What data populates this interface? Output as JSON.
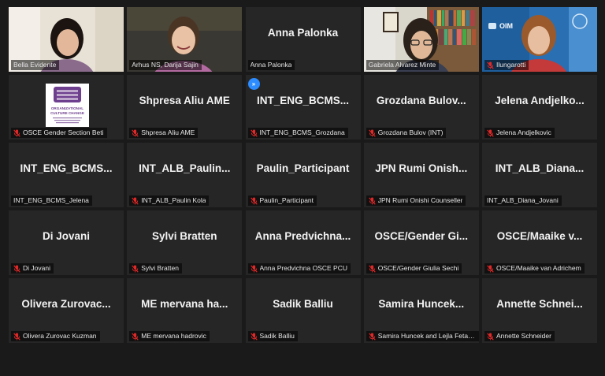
{
  "participants": [
    {
      "name": "Bella Evidente",
      "display": "",
      "muted": false,
      "video": "person-woman-dark-hair",
      "active": true
    },
    {
      "name": "Arhus NS, Darija Sajin",
      "display": "",
      "muted": false,
      "video": "person-woman-smiling"
    },
    {
      "name": "Anna Palonka",
      "display": "Anna Palonka",
      "muted": false
    },
    {
      "name": "Gabriela Alvarez Minte",
      "display": "",
      "muted": false,
      "video": "person-glasses-bookshelf"
    },
    {
      "name": "Ilungarotti",
      "display": "",
      "muted": true,
      "video": "person-woman-oim-banner"
    },
    {
      "name": "OSCE Gender Section Beti",
      "display": "",
      "muted": true,
      "video": "organizational-culture-change-logo"
    },
    {
      "name": "Shpresa Aliu AME",
      "display": "Shpresa Aliu AME",
      "muted": true
    },
    {
      "name": "INT_ENG_BCMS_Grozdana",
      "display": "INT_ENG_BCMS...",
      "muted": true,
      "spotlight": true
    },
    {
      "name": "Grozdana Bulov (INT)",
      "display": "Grozdana Bulov...",
      "muted": true
    },
    {
      "name": "Jelena Andjelkovic",
      "display": "Jelena Andjelko...",
      "muted": true
    },
    {
      "name": "INT_ENG_BCMS_Jelena",
      "display": "INT_ENG_BCMS...",
      "muted": false
    },
    {
      "name": "INT_ALB_Paulin Kola",
      "display": "INT_ALB_Paulin...",
      "muted": true
    },
    {
      "name": "Paulin_Participant",
      "display": "Paulin_Participant",
      "muted": true
    },
    {
      "name": "JPN Rumi Onishi Counseller",
      "display": "JPN Rumi Onish...",
      "muted": true
    },
    {
      "name": "INT_ALB_Diana_Jovani",
      "display": "INT_ALB_Diana...",
      "muted": false
    },
    {
      "name": "Di Jovani",
      "display": "Di Jovani",
      "muted": true
    },
    {
      "name": "Sylvi Bratten",
      "display": "Sylvi Bratten",
      "muted": true
    },
    {
      "name": "Anna Predvichna OSCE PCU",
      "display": "Anna Predvichna...",
      "muted": true
    },
    {
      "name": "OSCE/Gender Giulia Sechi",
      "display": "OSCE/Gender Gi...",
      "muted": true
    },
    {
      "name": "OSCE/Maaike van Adrichem",
      "display": "OSCE/Maaike v...",
      "muted": true
    },
    {
      "name": "Olivera Zurovac Kuzman",
      "display": "Olivera Zurovac...",
      "muted": true
    },
    {
      "name": "ME mervana hadrovic",
      "display": "ME mervana ha...",
      "muted": true
    },
    {
      "name": "Sadik Balliu",
      "display": "Sadik Balliu",
      "muted": true
    },
    {
      "name": "Samira Huncek and Lejla Fetah...",
      "display": "Samira Huncek...",
      "muted": true
    },
    {
      "name": "Annette Schneider",
      "display": "Annette Schnei...",
      "muted": true
    }
  ],
  "logo_text": {
    "line1": "ORGANIZATIONAL",
    "line2": "CULTURE CHANGE"
  },
  "oim_banner_text": "OIM",
  "colors": {
    "background": "#1a1a1a",
    "tile": "#262626",
    "active_border": "#d6e54a",
    "muted_icon": "#e02828",
    "spotlight": "#2d8cff"
  },
  "icons": {
    "muted": "microphone-muted-icon",
    "spotlight": "spotlight-icon"
  }
}
